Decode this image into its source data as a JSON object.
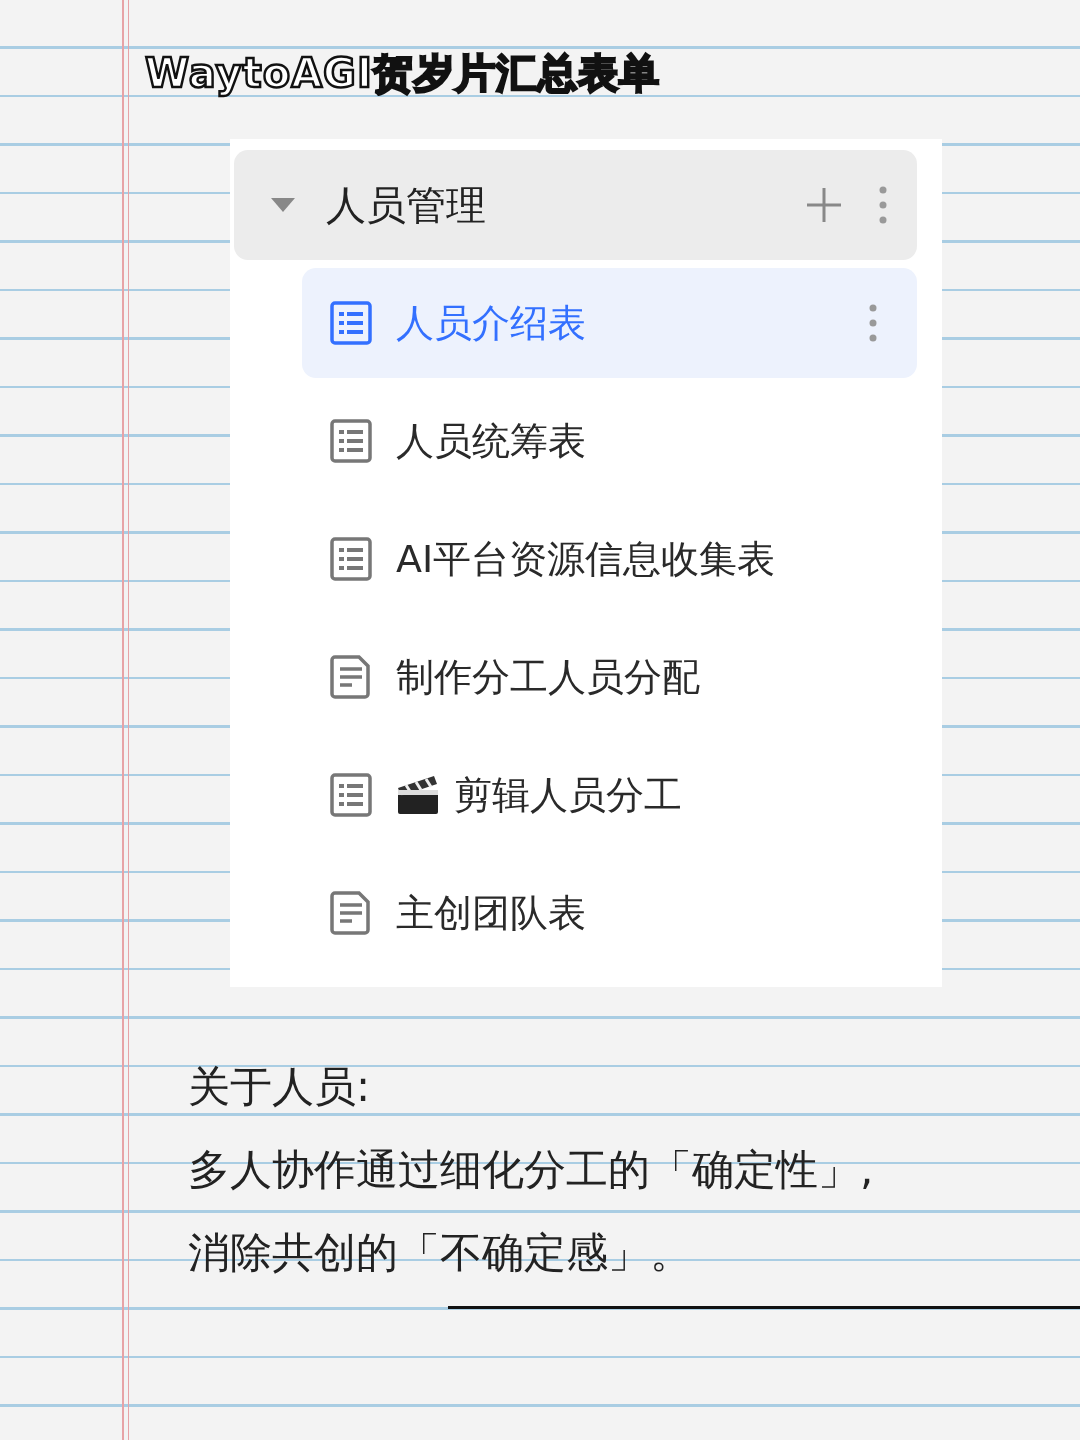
{
  "title": "WaytoAGI贺岁片汇总表单",
  "folder": {
    "label": "人员管理",
    "expanded": true,
    "items": [
      {
        "label": "人员介绍表",
        "kind": "table",
        "selected": true,
        "clapper": false
      },
      {
        "label": "人员统筹表",
        "kind": "table",
        "selected": false,
        "clapper": false
      },
      {
        "label": "AI平台资源信息收集表",
        "kind": "table",
        "selected": false,
        "clapper": false
      },
      {
        "label": "制作分工人员分配",
        "kind": "doc",
        "selected": false,
        "clapper": false
      },
      {
        "label": "剪辑人员分工",
        "kind": "table",
        "selected": false,
        "clapper": true
      },
      {
        "label": "主创团队表",
        "kind": "doc",
        "selected": false,
        "clapper": false
      }
    ]
  },
  "note": [
    "关于人员:",
    "多人协作通过细化分工的「确定性」,",
    "消除共创的「不确定感」。"
  ]
}
